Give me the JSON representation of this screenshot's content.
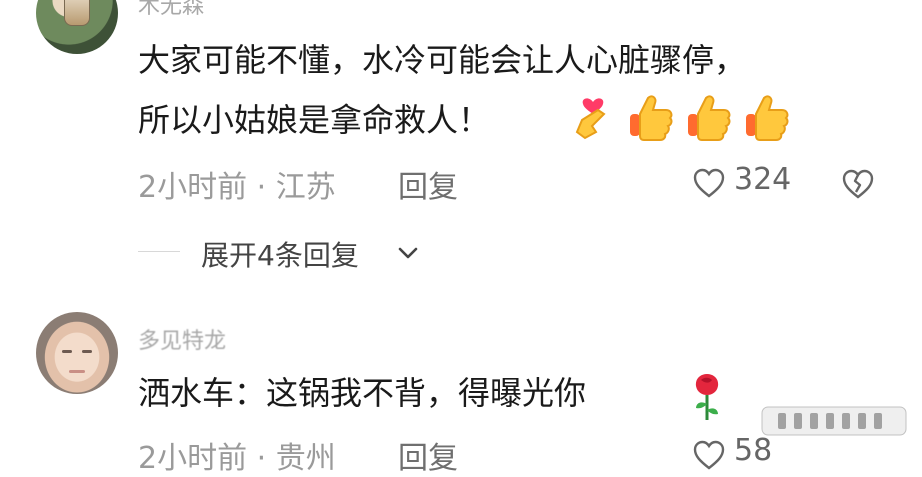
{
  "comments": [
    {
      "username": "木无森",
      "text_line1": "大家可能不懂，水冷可能会让人心脏骤停，",
      "text_line2": "所以小姑娘是拿命救人！",
      "emoji": [
        "heart-hand",
        "thumbs-up",
        "thumbs-up",
        "thumbs-up"
      ],
      "time_location": "2小时前 · 江苏",
      "reply_label": "回复",
      "likes": "324",
      "expand_replies": "展开4条回复"
    },
    {
      "username": "多见特龙",
      "text": "洒水车：这锅我不背，得曝光你",
      "emoji": [
        "rose"
      ],
      "time_location": "2小时前 · 贵州",
      "reply_label": "回复",
      "likes": "58"
    }
  ],
  "colors": {
    "primary_text": "#1a1a1a",
    "meta_text": "#9a9a9a",
    "username_text": "#a8a8a8",
    "background": "#ffffff"
  },
  "icons": {
    "like": "heart-outline-icon",
    "dislike": "broken-heart-outline-icon",
    "expand": "chevron-down-icon"
  }
}
